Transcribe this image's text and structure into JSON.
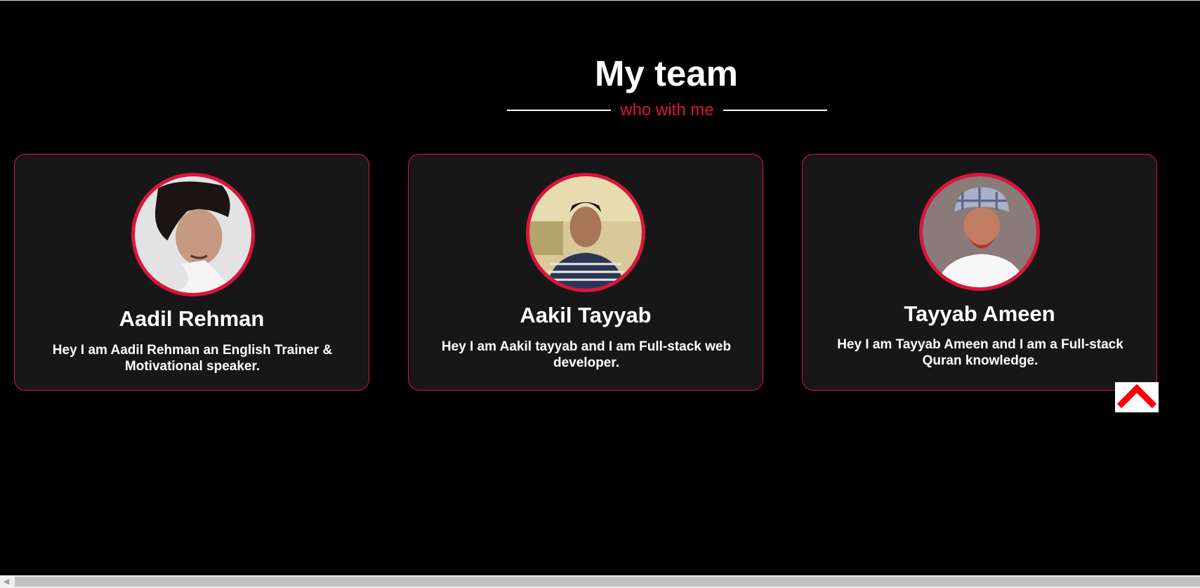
{
  "section": {
    "title": "My team",
    "subtitle": "who with me"
  },
  "members": [
    {
      "name": "Aadil Rehman",
      "description": "Hey I am Aadil Rehman an English Trainer & Motivational speaker."
    },
    {
      "name": "Aakil Tayyab",
      "description": "Hey I am Aakil tayyab and I am Full-stack web developer."
    },
    {
      "name": "Tayyab Ameen",
      "description": "Hey I am Tayyab Ameen and I am a Full-stack Quran knowledge."
    }
  ],
  "scroll_top": {
    "icon": "chevron-up-icon"
  },
  "colors": {
    "background": "#000000",
    "accent": "#dc143c",
    "card": "#171717",
    "text": "#ffffff"
  }
}
